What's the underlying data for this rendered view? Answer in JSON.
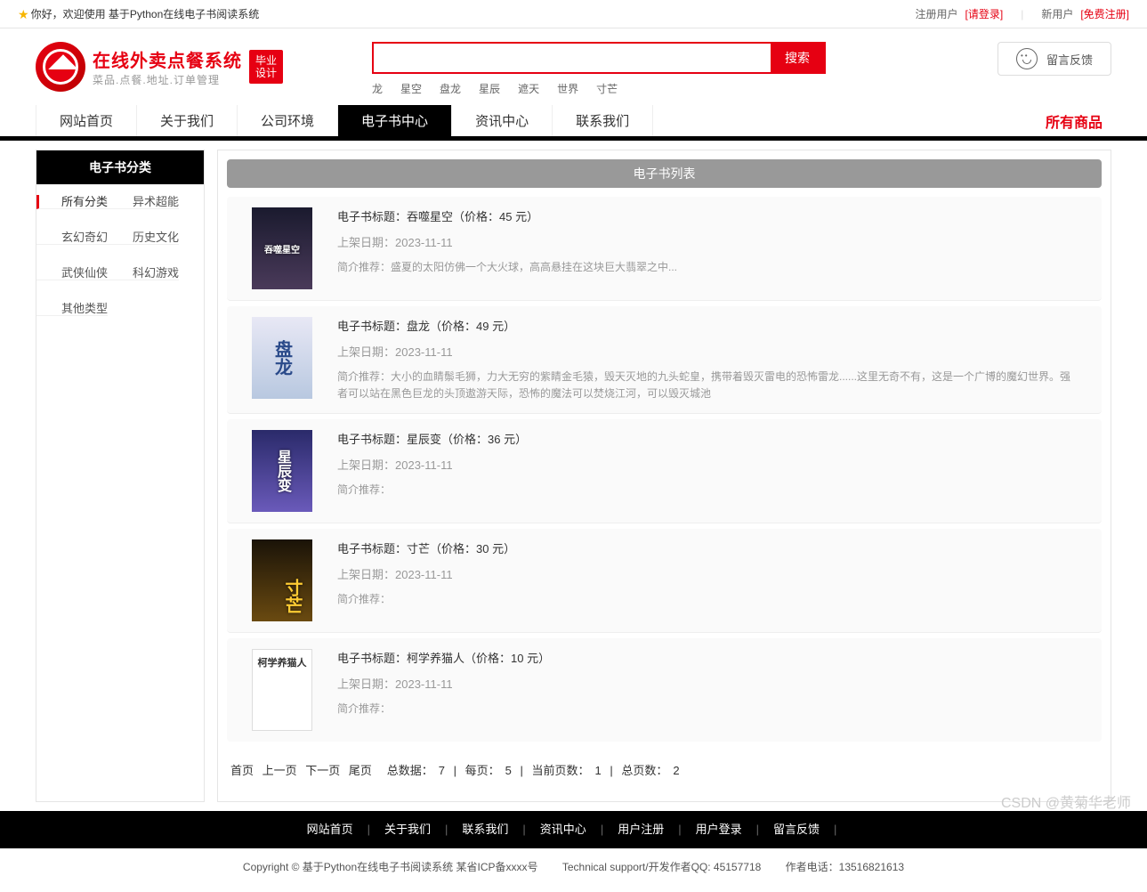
{
  "topbar": {
    "greeting": "你好，欢迎使用 基于Python在线电子书阅读系统",
    "reg_user": "注册用户",
    "login": "[请登录]",
    "new_user": "新用户",
    "free_reg": "[免费注册]"
  },
  "logo": {
    "cn": "在线外卖点餐系统",
    "sub": "菜品.点餐.地址.订单管理",
    "badge1": "毕业",
    "badge2": "设计"
  },
  "search": {
    "placeholder": "",
    "button": "搜索",
    "hotwords": [
      "龙",
      "星空",
      "盘龙",
      "星辰",
      "遮天",
      "世界",
      "寸芒"
    ]
  },
  "feedback": {
    "label": "留言反馈"
  },
  "nav": {
    "items": [
      "网站首页",
      "关于我们",
      "公司环境",
      "电子书中心",
      "资讯中心",
      "联系我们"
    ],
    "active_index": 3,
    "all": "所有商品"
  },
  "sidebar": {
    "title": "电子书分类",
    "cats": [
      "所有分类",
      "异术超能",
      "玄幻奇幻",
      "历史文化",
      "武侠仙侠",
      "科幻游戏",
      "其他类型"
    ],
    "current_index": 0
  },
  "list": {
    "title": "电子书列表",
    "label_title": "电子书标题：",
    "label_price_pre": "（价格：",
    "label_price_suf": " 元）",
    "label_date": "上架日期：",
    "label_desc": "简介推荐：",
    "items": [
      {
        "title": "吞噬星空",
        "price": "45",
        "date": "2023-11-11",
        "desc": "盛夏的太阳仿佛一个大火球，高高悬挂在这块巨大翡翠之中...",
        "cov": "cov1",
        "covtext": "吞噬星空"
      },
      {
        "title": "盘龙",
        "price": "49",
        "date": "2023-11-11",
        "desc": "大小的血睛鬃毛狮，力大无穷的紫睛金毛猿，毁天灭地的九头蛇皇，携带着毁灭雷电的恐怖雷龙......这里无奇不有，这是一个广博的魔幻世界。强者可以站在黑色巨龙的头顶遨游天际，恐怖的魔法可以焚烧江河，可以毁灭城池",
        "cov": "cov2",
        "covtext": "盘龙"
      },
      {
        "title": "星辰变",
        "price": "36",
        "date": "2023-11-11",
        "desc": "",
        "cov": "cov3",
        "covtext": "星辰变"
      },
      {
        "title": "寸芒",
        "price": "30",
        "date": "2023-11-11",
        "desc": "",
        "cov": "cov4",
        "covtext": "寸芒"
      },
      {
        "title": "柯学养猫人",
        "price": "10",
        "date": "2023-11-11",
        "desc": "",
        "cov": "cov5",
        "covtext": "柯学养猫人"
      }
    ]
  },
  "pager": {
    "first": "首页",
    "prev": "上一页",
    "next": "下一页",
    "last": "尾页",
    "total_label": "总数据：",
    "total": "7",
    "per_label": "每页：",
    "per": "5",
    "cur_label": "当前页数：",
    "cur": "1",
    "pages_label": "总页数：",
    "pages": "2"
  },
  "footer_nav": [
    "网站首页",
    "关于我们",
    "联系我们",
    "资讯中心",
    "用户注册",
    "用户登录",
    "留言反馈"
  ],
  "copyright": {
    "c1": "Copyright © 基于Python在线电子书阅读系统 某省ICP备xxxx号",
    "c2": "Technical support/开发作者QQ: 45157718",
    "c3": "作者电话：13516821613"
  },
  "watermark": "CSDN @黄菊华老师"
}
